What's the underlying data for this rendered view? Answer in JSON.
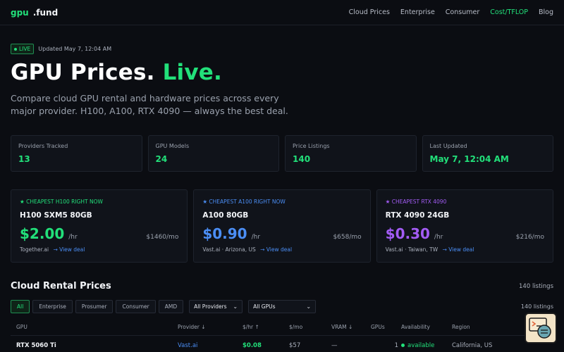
{
  "nav": {
    "logo_a": "gpu",
    "logo_b": ".fund",
    "links": [
      "Cloud Prices",
      "Enterprise",
      "Consumer",
      "Cost/TFLOP",
      "Blog"
    ]
  },
  "status": {
    "badge": "LIVE",
    "updated": "Updated May 7, 12:04 AM"
  },
  "hero": {
    "title_main": "GPU Prices.",
    "title_accent": "Live.",
    "subtitle": "Compare cloud GPU rental and hardware prices across every major provider. H100, A100, RTX 4090 — always the best deal."
  },
  "stats": [
    {
      "label": "Providers Tracked",
      "value": "13"
    },
    {
      "label": "GPU Models",
      "value": "24"
    },
    {
      "label": "Price Listings",
      "value": "140"
    },
    {
      "label": "Last Updated",
      "value": "May 7, 12:04 AM"
    }
  ],
  "deals": [
    {
      "tag": "★ CHEAPEST H100 RIGHT NOW",
      "name": "H100 SXM5 80GB",
      "price": "$2.00",
      "unit": "/hr",
      "monthly": "$1460/mo",
      "source": "Together.ai",
      "link": "→ View deal",
      "color": "#22e07a"
    },
    {
      "tag": "★ CHEAPEST A100 RIGHT NOW",
      "name": "A100 80GB",
      "price": "$0.90",
      "unit": "/hr",
      "monthly": "$658/mo",
      "source": "Vast.ai · Arizona, US",
      "link": "→ View deal",
      "color": "#4b8ef5"
    },
    {
      "tag": "★ CHEAPEST RTX 4090",
      "name": "RTX 4090 24GB",
      "price": "$0.30",
      "unit": "/hr",
      "monthly": "$216/mo",
      "source": "Vast.ai · Taiwan, TW",
      "link": "→ View deal",
      "color": "#a35cf5"
    }
  ],
  "section": {
    "title": "Cloud Rental Prices",
    "count": "140 listings"
  },
  "filters": {
    "buttons": [
      "All",
      "Enterprise",
      "Prosumer",
      "Consumer",
      "AMD"
    ],
    "provider_select": "All Providers",
    "gpu_select": "All GPUs",
    "count": "140 listings"
  },
  "table": {
    "headers": [
      "GPU",
      "Provider ↓",
      "$/hr ↑",
      "$/mo",
      "VRAM ↓",
      "GPUs",
      "Availability",
      "Region"
    ],
    "rows": [
      {
        "gpu": "RTX 5060 Ti",
        "provider": "Vast.ai",
        "hr": "$0.08",
        "mo": "$57",
        "vram": "—",
        "gpus": "1",
        "availability": "available",
        "region": "California, US"
      }
    ]
  },
  "colors": {
    "accent": "#22e07a",
    "link": "#4b8ef5",
    "purple": "#a35cf5",
    "bg": "#0b0d12"
  }
}
